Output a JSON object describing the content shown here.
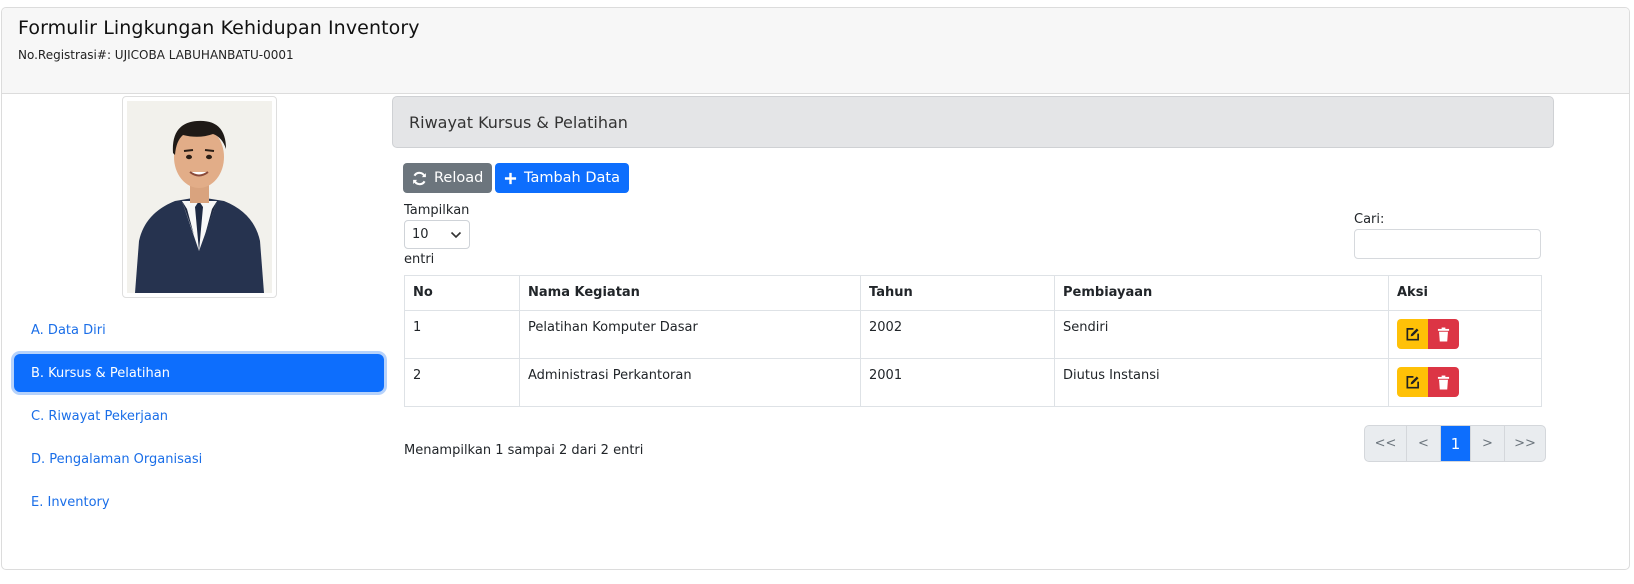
{
  "header": {
    "title": "Formulir Lingkungan Kehidupan Inventory",
    "registration": "No.Registrasi#: UJICOBA LABUHANBATU-0001"
  },
  "sidebar": {
    "items": [
      {
        "label": "A. Data Diri",
        "active": false
      },
      {
        "label": "B. Kursus & Pelatihan",
        "active": true
      },
      {
        "label": "C. Riwayat Pekerjaan",
        "active": false
      },
      {
        "label": "D. Pengalaman Organisasi",
        "active": false
      },
      {
        "label": "E. Inventory",
        "active": false
      }
    ]
  },
  "panel": {
    "title": "Riwayat Kursus & Pelatihan"
  },
  "toolbar": {
    "reload_label": "Reload",
    "add_label": "Tambah Data"
  },
  "length": {
    "label": "Tampilkan",
    "value": "10",
    "suffix": "entri"
  },
  "search": {
    "label": "Cari:",
    "value": "",
    "placeholder": ""
  },
  "table": {
    "columns": [
      "No",
      "Nama Kegiatan",
      "Tahun",
      "Pembiayaan",
      "Aksi"
    ],
    "rows": [
      {
        "no": "1",
        "nama": "Pelatihan Komputer Dasar",
        "tahun": "2002",
        "pembiayaan": "Sendiri"
      },
      {
        "no": "2",
        "nama": "Administrasi Perkantoran",
        "tahun": "2001",
        "pembiayaan": "Diutus Instansi"
      }
    ]
  },
  "footer": {
    "info": "Menampilkan 1 sampai 2 dari 2 entri"
  },
  "pagination": {
    "first": "<<",
    "prev": "<",
    "current": "1",
    "next": ">",
    "last": ">>"
  },
  "colors": {
    "primary": "#0d6efd",
    "secondary": "#6c757d",
    "warning": "#ffc107",
    "danger": "#dc3545"
  },
  "icons": {
    "reload": "refresh-icon",
    "add": "plus-icon",
    "edit": "edit-icon",
    "delete": "trash-icon",
    "select": "chevron-down-icon"
  }
}
